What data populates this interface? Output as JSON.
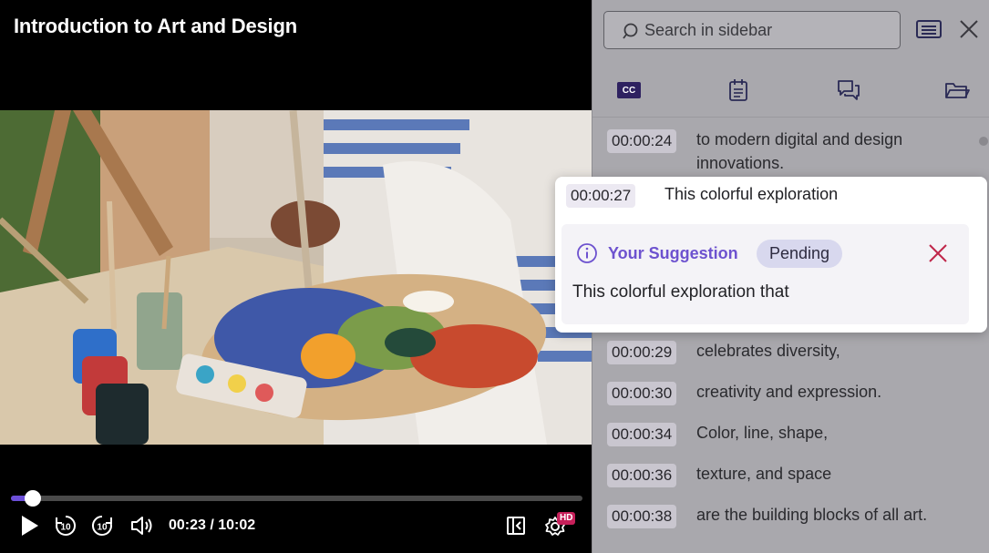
{
  "player": {
    "title": "Introduction to Art and Design",
    "current_time": "00:23",
    "duration": "10:02",
    "time_display": "00:23 / 10:02",
    "progress_fraction": 0.038,
    "quality_badge": "HD",
    "accent_color": "#6c4fd8",
    "controls": {
      "play": "play-icon",
      "rewind": "rewind-10-icon",
      "forward": "forward-10-icon",
      "volume": "volume-icon",
      "sidebar": "collapse-sidebar-icon",
      "settings": "settings-gear-icon",
      "skip_seconds": "10"
    }
  },
  "sidebar": {
    "search_placeholder": "Search in sidebar",
    "tabs": [
      {
        "name": "captions",
        "label": "CC"
      },
      {
        "name": "notes",
        "icon": "notepad-icon"
      },
      {
        "name": "discussion",
        "icon": "chat-icon"
      },
      {
        "name": "files",
        "icon": "folder-icon"
      }
    ],
    "transcript": [
      {
        "time": "00:00:24",
        "text": "to modern digital and design innovations."
      },
      {
        "time": "00:00:29",
        "text": "celebrates diversity,"
      },
      {
        "time": "00:00:30",
        "text": "creativity and expression."
      },
      {
        "time": "00:00:34",
        "text": "Color, line, shape,"
      },
      {
        "time": "00:00:36",
        "text": "texture, and space"
      },
      {
        "time": "00:00:38",
        "text": "are the building blocks of all art."
      }
    ]
  },
  "popup": {
    "time": "00:00:27",
    "cue_text": "This colorful exploration",
    "suggestion_label": "Your Suggestion",
    "status": "Pending",
    "suggestion_text": "This colorful exploration that",
    "accent_color": "#6d52cf",
    "dismiss_color": "#c0264a"
  }
}
